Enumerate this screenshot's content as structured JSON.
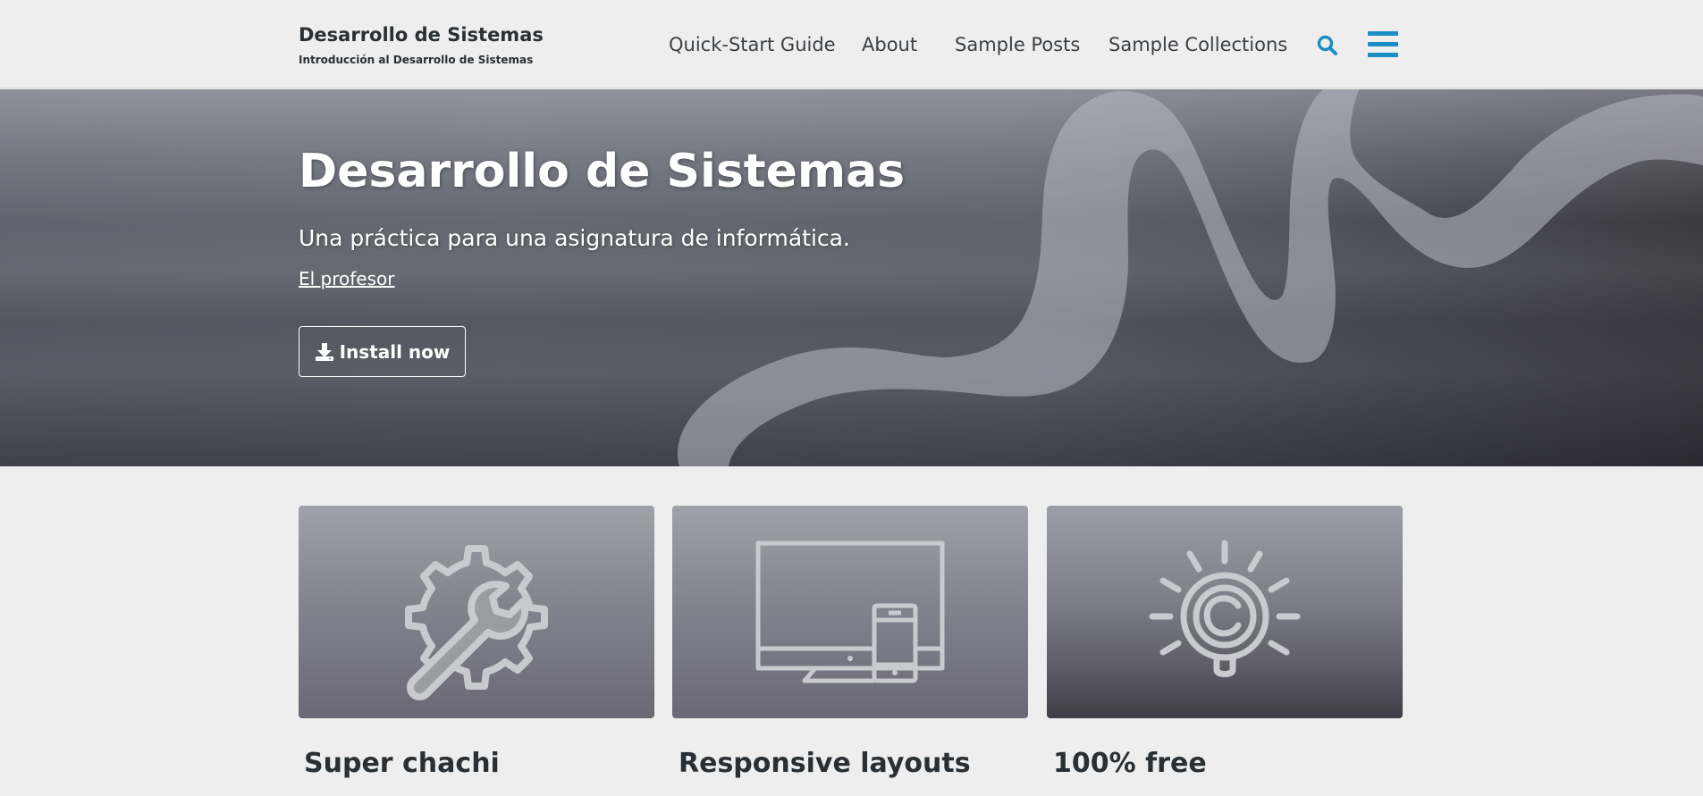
{
  "header": {
    "site_title": "Desarrollo de Sistemas",
    "site_subtitle": "Introducción al Desarrollo de Sistemas",
    "nav": [
      {
        "label": "Quick-Start Guide"
      },
      {
        "label": "About"
      },
      {
        "label": "Sample Posts"
      },
      {
        "label": "Sample Collections"
      }
    ],
    "search_icon": "search-icon",
    "menu_icon": "hamburger-menu-icon",
    "accent_color": "#1b8ec4"
  },
  "hero": {
    "title": "Desarrollo de Sistemas",
    "tagline": "Una práctica para una asignatura de informática.",
    "link_label": "El profesor",
    "button_label": "Install now",
    "button_icon": "download-icon"
  },
  "features": [
    {
      "title": "Super chachi",
      "icon": "gear-wrench-icon"
    },
    {
      "title": "Responsive layouts",
      "icon": "responsive-devices-icon"
    },
    {
      "title": "100% free",
      "icon": "copyright-lightbulb-icon"
    }
  ]
}
